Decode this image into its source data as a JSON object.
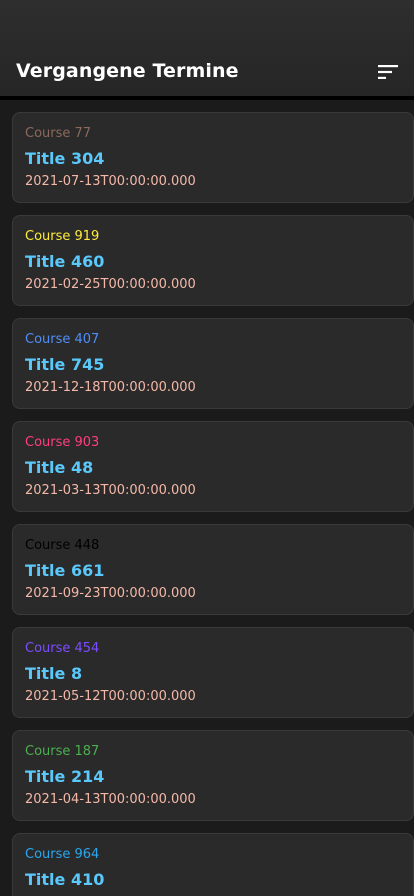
{
  "header": {
    "title": "Vergangene Termine"
  },
  "colors": {
    "title_text": "#5ac8fa",
    "date_text": "#f4b8a8",
    "card_bg": "#2a2a2a",
    "page_bg": "#1b1b1b"
  },
  "items": [
    {
      "course": "Course 77",
      "course_color": "#8a6a5c",
      "title": "Title 304",
      "date": "2021-07-13T00:00:00.000"
    },
    {
      "course": "Course 919",
      "course_color": "#ffeb3b",
      "title": "Title 460",
      "date": "2021-02-25T00:00:00.000"
    },
    {
      "course": "Course 407",
      "course_color": "#4f8ef7",
      "title": "Title 745",
      "date": "2021-12-18T00:00:00.000"
    },
    {
      "course": "Course 903",
      "course_color": "#ff3d7f",
      "title": "Title 48",
      "date": "2021-03-13T00:00:00.000"
    },
    {
      "course": "Course 448",
      "course_color": "#000000",
      "title": "Title 661",
      "date": "2021-09-23T00:00:00.000"
    },
    {
      "course": "Course 454",
      "course_color": "#7c4dff",
      "title": "Title 8",
      "date": "2021-05-12T00:00:00.000"
    },
    {
      "course": "Course 187",
      "course_color": "#4caf50",
      "title": "Title 214",
      "date": "2021-04-13T00:00:00.000"
    },
    {
      "course": "Course 964",
      "course_color": "#29a8f0",
      "title": "Title 410",
      "date": ""
    }
  ]
}
